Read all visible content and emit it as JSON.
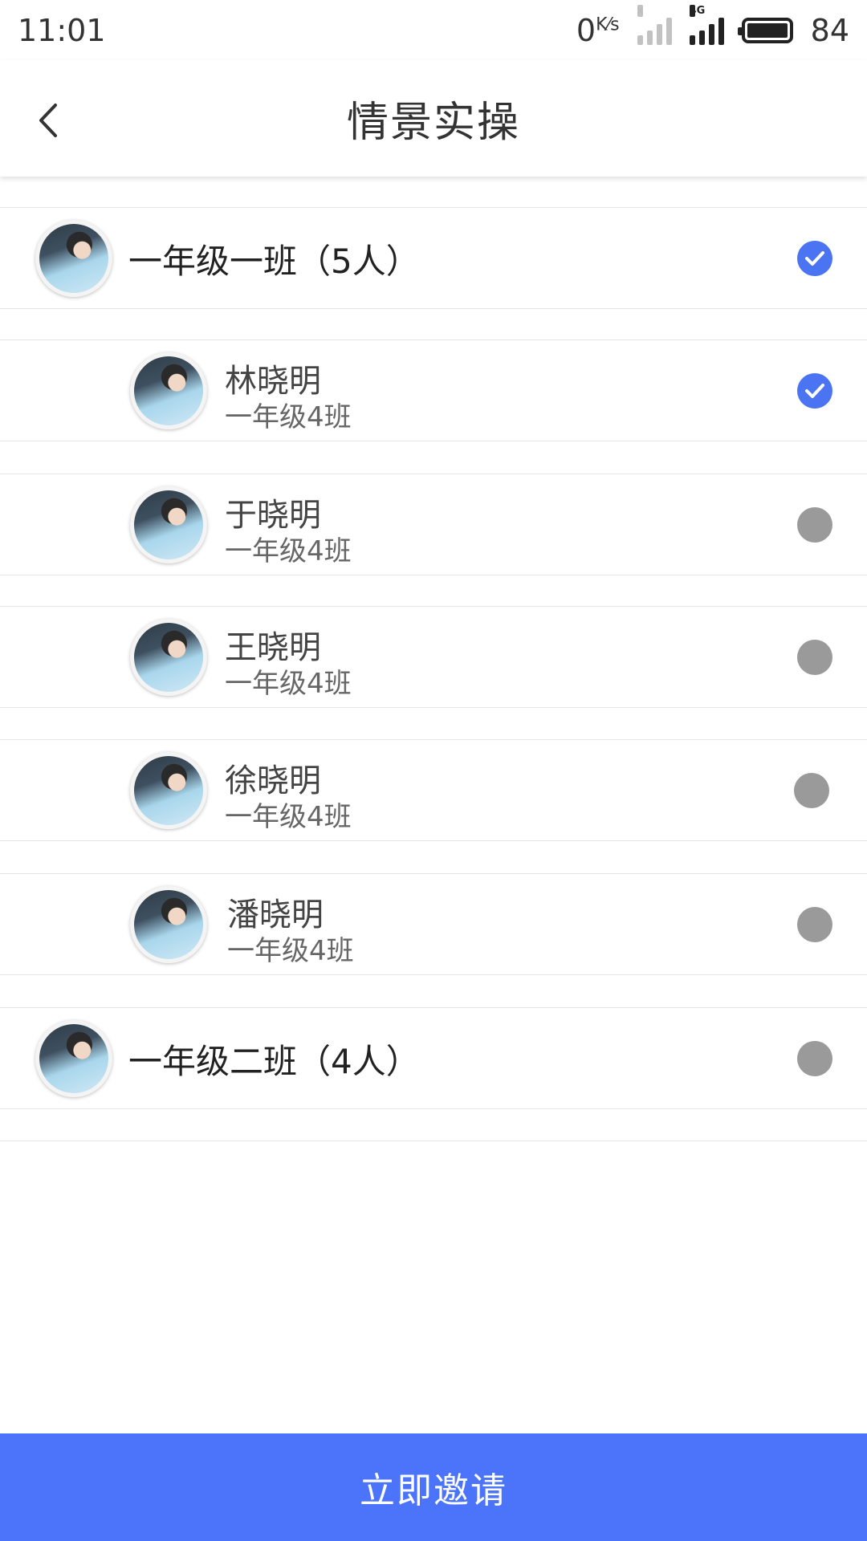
{
  "status_bar": {
    "time": "11:01",
    "net_speed_value": "0",
    "net_speed_unit": "K⁄s",
    "sim1_tag": "x",
    "sim2_tag": "4G",
    "battery_level": "84"
  },
  "header": {
    "title": "情景实操"
  },
  "groups": [
    {
      "label": "一年级一班（5人）",
      "selected": true
    },
    {
      "label": "一年级二班（4人）",
      "selected": false
    }
  ],
  "members": [
    {
      "name": "林晓明",
      "class": "一年级4班",
      "selected": true
    },
    {
      "name": "于晓明",
      "class": "一年级4班",
      "selected": false
    },
    {
      "name": "王晓明",
      "class": "一年级4班",
      "selected": false
    },
    {
      "name": "徐晓明",
      "class": "一年级4班",
      "selected": false
    },
    {
      "name": "潘晓明",
      "class": "一年级4班",
      "selected": false
    }
  ],
  "footer": {
    "invite_label": "立即邀请"
  },
  "colors": {
    "accent": "#4b74fb",
    "check_on": "#4a74f2",
    "check_off": "#9a9a9a"
  }
}
